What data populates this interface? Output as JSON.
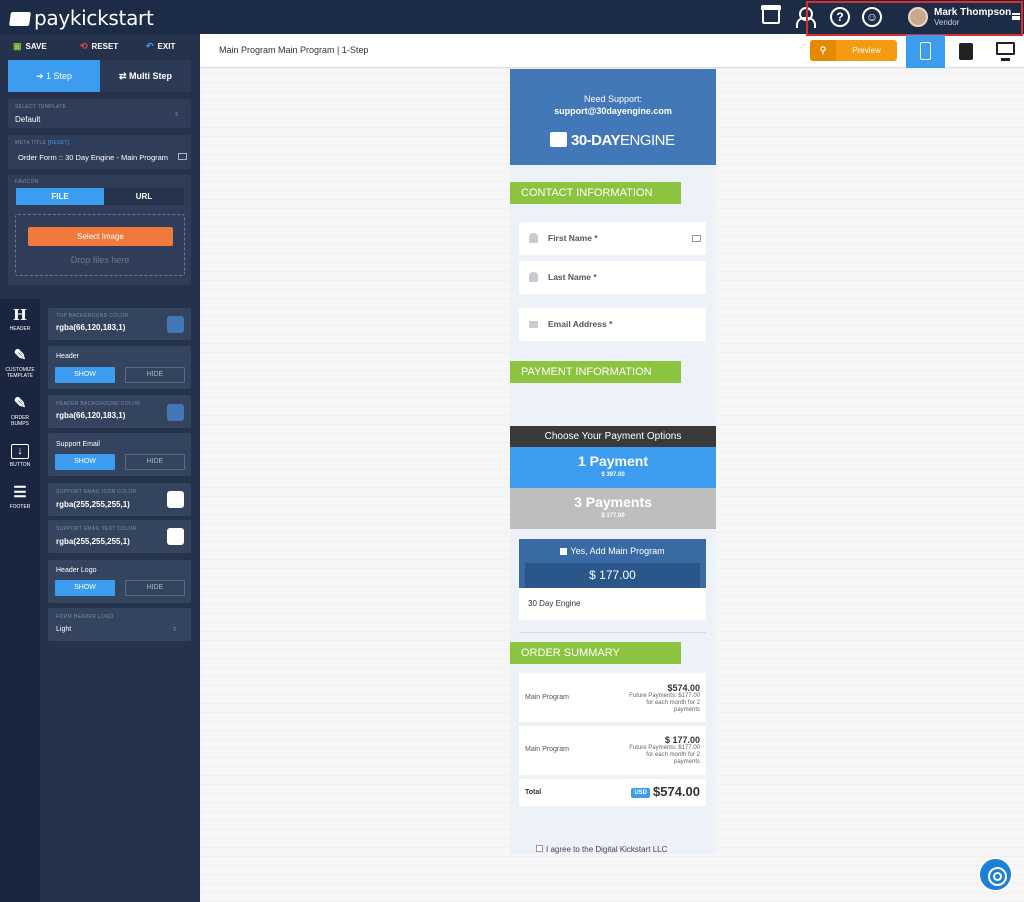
{
  "app": {
    "brand_light": "pay",
    "brand_rest": "kickstart"
  },
  "user": {
    "name": "Mark Thompson",
    "role": "Vendor"
  },
  "toolbar": {
    "save": "SAVE",
    "reset": "RESET",
    "exit": "EXIT"
  },
  "steps": {
    "one": "1 Step",
    "multi": "Multi Step"
  },
  "template": {
    "label": "SELECT TEMPLATE",
    "value": "Default"
  },
  "meta": {
    "label": "META TITLE",
    "reset": "[RESET]",
    "value": "Order Form :: 30 Day Engine - Main Program"
  },
  "favicon": {
    "label": "FAVICON",
    "file": "FILE",
    "url": "URL",
    "select": "Select Image",
    "drop": "Drop files here"
  },
  "iconbar": {
    "header": "HEADER",
    "customize": "CUSTOMIZE TEMPLATE",
    "customize_l1": "CUSTOMIZE",
    "customize_l2": "TEMPLATE",
    "bumps_l1": "ORDER",
    "bumps_l2": "BUMPS",
    "button": "BUTTON",
    "footer": "FOOTER"
  },
  "options": {
    "top_bg": {
      "label": "TOP BACKGROUND COLOR",
      "value": "rgba(66,120,183,1)",
      "color": "#4278b7"
    },
    "header": {
      "label": "Header",
      "show": "SHOW",
      "hide": "HIDE"
    },
    "header_bg": {
      "label": "HEADER BACKGROUND COLOR",
      "value": "rgba(66,120,183,1)",
      "color": "#4278b7"
    },
    "support_email": {
      "label": "Support Email",
      "show": "SHOW",
      "hide": "HIDE"
    },
    "email_icon": {
      "label": "SUPPORT EMAIL ICON COLOR",
      "value": "rgba(255,255,255,1)",
      "color": "#ffffff"
    },
    "email_text": {
      "label": "SUPPORT EMAIL TEXT COLOR",
      "value": "rgba(255,255,255,1)",
      "color": "#ffffff"
    },
    "header_logo": {
      "label": "Header Logo",
      "show": "SHOW",
      "hide": "HIDE"
    },
    "form_logo": {
      "label": "FORM HEADER LOGO",
      "value": "Light"
    }
  },
  "subheader": {
    "title": "Main Program Main Program | 1-Step",
    "preview": "Preview"
  },
  "form": {
    "need_support": "Need Support:",
    "support_email": "support@30dayengine.com",
    "brand_bold": "30-DAY",
    "brand_thin": "ENGINE",
    "contact_title": "CONTACT INFORMATION",
    "first_name": "First Name *",
    "last_name": "Last Name *",
    "email": "Email Address *",
    "payment_title": "PAYMENT INFORMATION",
    "choose": "Choose Your Payment Options",
    "pay1_title": "1 Payment",
    "pay1_price": "$ 397.00",
    "pay2_title": "3 Payments",
    "pay2_price": "$ 177.00",
    "bump_label": "Yes, Add Main Program",
    "bump_price": "$ 177.00",
    "bump_product": "30 Day Engine",
    "summary_title": "ORDER SUMMARY",
    "row1": {
      "name": "Main Program",
      "price": "$574.00",
      "future1": "Future Payments: $177.00",
      "future2": "for each month for 2",
      "future3": "payments"
    },
    "row2": {
      "name": "Main Program",
      "price": "$ 177.00",
      "future1": "Future Payments: $177.00",
      "future2": "for each month for 2",
      "future3": "payments"
    },
    "total_label": "Total",
    "total_currency": "USD",
    "total_value": "$574.00",
    "agree": "I agree to the Digital Kickstart LLC"
  },
  "colors": {
    "accent": "#3b9cf0",
    "green": "#8cc43f",
    "header": "#4278b7",
    "preview": "#f49b12"
  }
}
